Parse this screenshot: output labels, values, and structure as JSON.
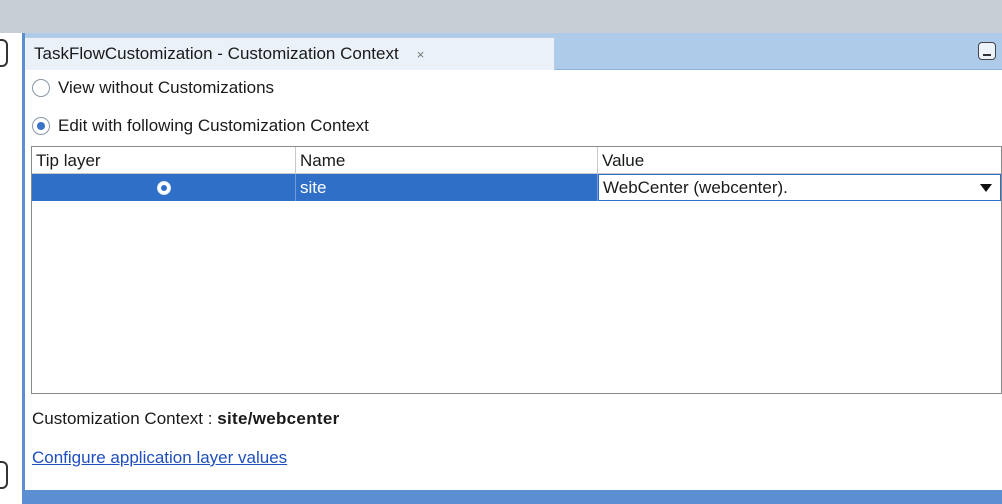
{
  "panel": {
    "tab_title": "TaskFlowCustomization - Customization Context",
    "tab_close": "×"
  },
  "options": {
    "view_without": "View without Customizations",
    "edit_with": "Edit with following Customization Context",
    "selected": "edit_with"
  },
  "table": {
    "headers": [
      "Tip layer",
      "Name",
      "Value"
    ],
    "rows": [
      {
        "name": "site",
        "value": "WebCenter (webcenter).",
        "tip_layer_selected": true
      }
    ]
  },
  "context": {
    "label": "Customization Context : ",
    "value": "site/webcenter"
  },
  "link": {
    "configure": "Configure application layer values"
  },
  "colors": {
    "accent": "#2f6fc7",
    "tab_bar": "#aecbe9",
    "link": "#1f4fbf"
  }
}
